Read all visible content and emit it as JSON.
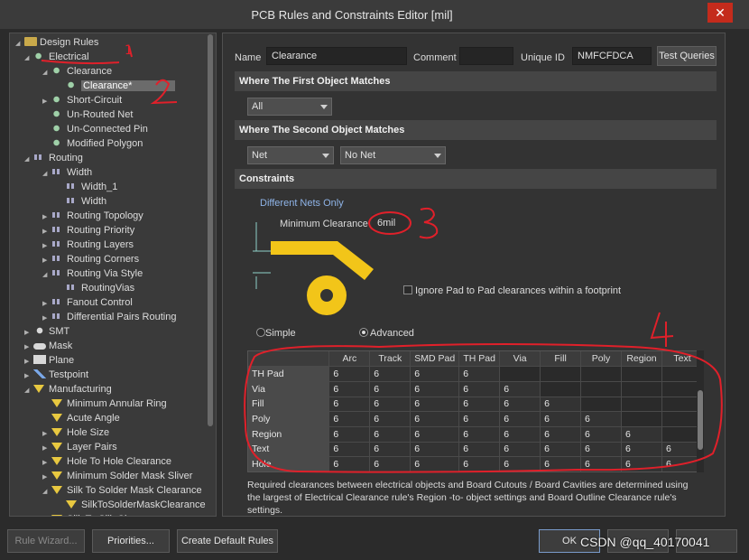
{
  "window": {
    "title": "PCB Rules and Constraints Editor [mil]",
    "close": "✕"
  },
  "tree": {
    "items": [
      {
        "label": "Design Rules",
        "icon": "folder"
      },
      {
        "label": "Electrical",
        "icon": "rule"
      },
      {
        "label": "Clearance",
        "icon": "rule"
      },
      {
        "label": "Clearance*",
        "icon": "rule"
      },
      {
        "label": "Short-Circuit",
        "icon": "rule"
      },
      {
        "label": "Un-Routed Net",
        "icon": "rule"
      },
      {
        "label": "Un-Connected Pin",
        "icon": "rule"
      },
      {
        "label": "Modified Polygon",
        "icon": "rule"
      },
      {
        "label": "Routing",
        "icon": "route"
      },
      {
        "label": "Width",
        "icon": "route"
      },
      {
        "label": "Width_1",
        "icon": "route"
      },
      {
        "label": "Width",
        "icon": "route"
      },
      {
        "label": "Routing Topology",
        "icon": "route"
      },
      {
        "label": "Routing Priority",
        "icon": "route"
      },
      {
        "label": "Routing Layers",
        "icon": "route"
      },
      {
        "label": "Routing Corners",
        "icon": "route"
      },
      {
        "label": "Routing Via Style",
        "icon": "route"
      },
      {
        "label": "RoutingVias",
        "icon": "route"
      },
      {
        "label": "Fanout Control",
        "icon": "route"
      },
      {
        "label": "Differential Pairs Routing",
        "icon": "route"
      },
      {
        "label": "SMT",
        "icon": "smt"
      },
      {
        "label": "Mask",
        "icon": "mask"
      },
      {
        "label": "Plane",
        "icon": "plane"
      },
      {
        "label": "Testpoint",
        "icon": "test"
      },
      {
        "label": "Manufacturing",
        "icon": "mfg"
      },
      {
        "label": "Minimum Annular Ring",
        "icon": "mfg"
      },
      {
        "label": "Acute Angle",
        "icon": "mfg"
      },
      {
        "label": "Hole Size",
        "icon": "mfg"
      },
      {
        "label": "Layer Pairs",
        "icon": "mfg"
      },
      {
        "label": "Hole To Hole Clearance",
        "icon": "mfg"
      },
      {
        "label": "Minimum Solder Mask Sliver",
        "icon": "mfg"
      },
      {
        "label": "Silk To Solder Mask Clearance",
        "icon": "mfg"
      },
      {
        "label": "SilkToSolderMaskClearance",
        "icon": "mfg"
      },
      {
        "label": "Silk To Silk Clearance",
        "icon": "mfg"
      }
    ]
  },
  "form": {
    "name_label": "Name",
    "name_value": "Clearance",
    "comment_label": "Comment",
    "comment_value": "",
    "uid_label": "Unique ID",
    "uid_value": "NMFCFDCA",
    "test_queries": "Test Queries"
  },
  "first_match": {
    "header": "Where The First Object Matches",
    "value": "All"
  },
  "second_match": {
    "header": "Where The Second Object Matches",
    "value1": "Net",
    "value2": "No Net"
  },
  "constraints": {
    "header": "Constraints",
    "different_nets": "Different Nets Only",
    "min_clearance_label": "Minimum Clearance",
    "min_clearance_value": "6mil",
    "ignore_pad": "Ignore Pad to Pad clearances within a footprint",
    "simple": "Simple",
    "advanced": "Advanced"
  },
  "grid": {
    "columns": [
      "",
      "Arc",
      "Track",
      "SMD Pad",
      "TH Pad",
      "Via",
      "Fill",
      "Poly",
      "Region",
      "Text"
    ],
    "rows": [
      {
        "name": "TH Pad",
        "values": [
          "6",
          "6",
          "6",
          "6",
          "",
          "",
          "",
          "",
          ""
        ]
      },
      {
        "name": "Via",
        "values": [
          "6",
          "6",
          "6",
          "6",
          "6",
          "",
          "",
          "",
          ""
        ]
      },
      {
        "name": "Fill",
        "values": [
          "6",
          "6",
          "6",
          "6",
          "6",
          "6",
          "",
          "",
          ""
        ]
      },
      {
        "name": "Poly",
        "values": [
          "6",
          "6",
          "6",
          "6",
          "6",
          "6",
          "6",
          "",
          ""
        ]
      },
      {
        "name": "Region",
        "values": [
          "6",
          "6",
          "6",
          "6",
          "6",
          "6",
          "6",
          "6",
          ""
        ]
      },
      {
        "name": "Text",
        "values": [
          "6",
          "6",
          "6",
          "6",
          "6",
          "6",
          "6",
          "6",
          "6"
        ]
      },
      {
        "name": "Hole",
        "values": [
          "6",
          "6",
          "6",
          "6",
          "6",
          "6",
          "6",
          "6",
          "6"
        ]
      }
    ]
  },
  "note": "Required clearances between electrical objects and Board Cutouts / Board Cavities are determined using the largest of Electrical Clearance rule's Region -to- object settings and Board Outline Clearance rule's settings.",
  "bottom": {
    "rule_wizard": "Rule Wizard...",
    "priorities": "Priorities...",
    "create_default": "Create Default Rules",
    "ok": "OK"
  },
  "watermark": "CSDN @qq_40170041",
  "annotations": [
    "1",
    "2",
    "3",
    "4"
  ],
  "colors": {
    "annotation": "#e0202a",
    "graphic": "#f2c519",
    "background": "#2b2b2b"
  }
}
